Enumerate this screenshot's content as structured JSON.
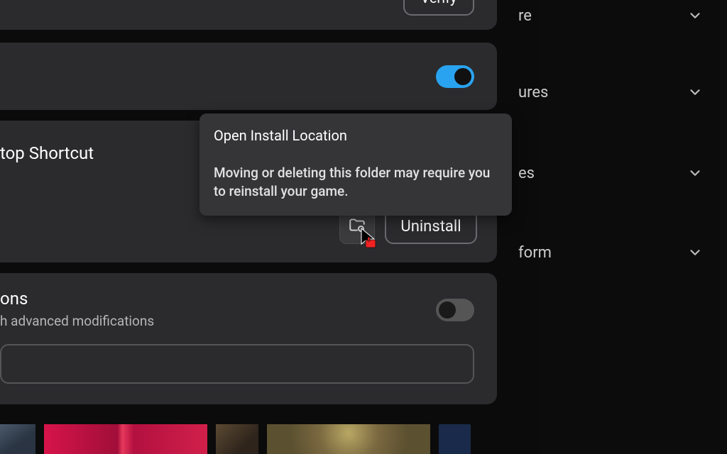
{
  "sidebar": {
    "items": [
      {
        "label": "re"
      },
      {
        "label": "ures"
      },
      {
        "label": "es"
      },
      {
        "label": "form"
      }
    ]
  },
  "verify": {
    "label": "Verify"
  },
  "shortcut": {
    "label": "top Shortcut"
  },
  "tooltip": {
    "title": "Open Install Location",
    "body": "Moving or deleting this folder may require you to reinstall your game."
  },
  "uninstall": {
    "label": "Uninstall"
  },
  "mods": {
    "heading": "ons",
    "subtext": "h advanced modifications"
  }
}
